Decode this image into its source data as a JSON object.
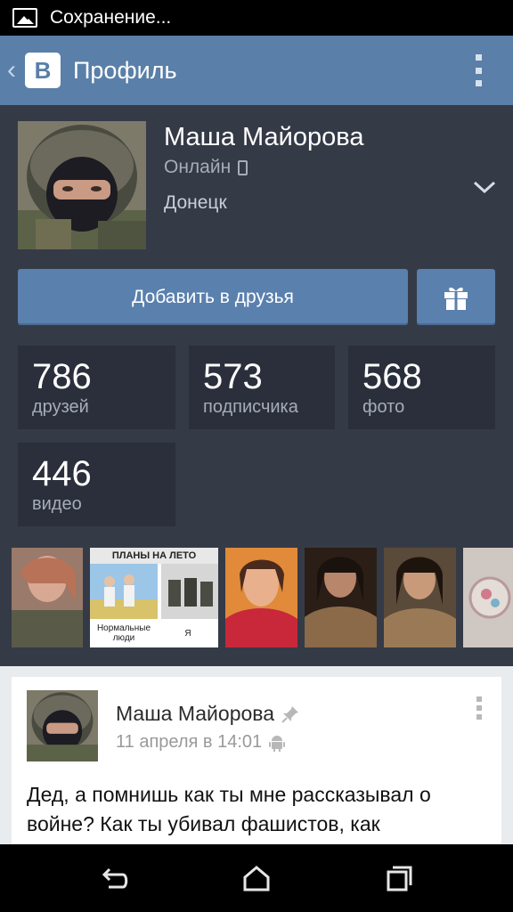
{
  "status_bar": {
    "text": "Сохранение..."
  },
  "toolbar": {
    "title": "Профиль",
    "logo": "B"
  },
  "profile": {
    "name": "Маша Майорова",
    "online": "Онлайн",
    "city": "Донецк",
    "add_friend_label": "Добавить в друзья"
  },
  "stats": [
    {
      "value": "786",
      "label": "друзей"
    },
    {
      "value": "573",
      "label": "подписчика"
    },
    {
      "value": "568",
      "label": "фото"
    },
    {
      "value": "446",
      "label": "видео"
    }
  ],
  "photos": {
    "meme_title": "ПЛАНЫ НА ЛЕТО",
    "meme_left": "Нормальные люди",
    "meme_right": "Я"
  },
  "post": {
    "author": "Маша Майорова",
    "date": "11 апреля в 14:01",
    "text": "Дед, а помнишь как ты мне рассказывал о войне? Как ты убивал фашистов, как"
  },
  "icons": {
    "back": "chevron-left-icon",
    "menu": "overflow-menu-icon",
    "gift": "gift-icon",
    "pin": "pin-icon",
    "android": "android-icon"
  },
  "colors": {
    "header": "#5a7fa8",
    "profile_bg": "#353a47",
    "stat_bg": "#2a2f3b",
    "button": "#5a80ad"
  }
}
